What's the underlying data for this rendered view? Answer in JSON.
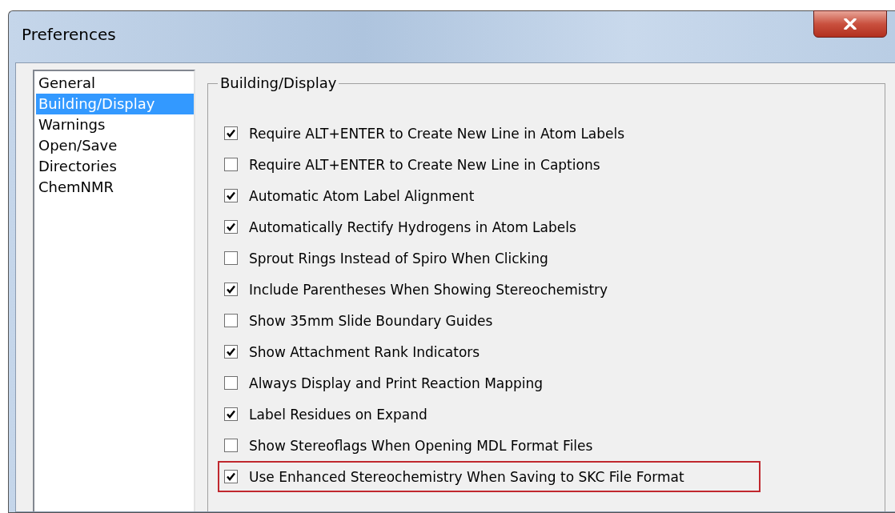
{
  "window": {
    "title": "Preferences"
  },
  "sidebar": {
    "items": [
      {
        "label": "General",
        "selected": false
      },
      {
        "label": "Building/Display",
        "selected": true
      },
      {
        "label": "Warnings",
        "selected": false
      },
      {
        "label": "Open/Save",
        "selected": false
      },
      {
        "label": "Directories",
        "selected": false
      },
      {
        "label": "ChemNMR",
        "selected": false
      }
    ]
  },
  "group": {
    "title": "Building/Display",
    "options": [
      {
        "label": "Require ALT+ENTER to Create New Line in Atom Labels",
        "checked": true,
        "highlighted": false
      },
      {
        "label": "Require ALT+ENTER to Create New Line in Captions",
        "checked": false,
        "highlighted": false
      },
      {
        "label": "Automatic Atom Label Alignment",
        "checked": true,
        "highlighted": false
      },
      {
        "label": "Automatically Rectify Hydrogens in Atom Labels",
        "checked": true,
        "highlighted": false
      },
      {
        "label": "Sprout Rings Instead of Spiro When Clicking",
        "checked": false,
        "highlighted": false
      },
      {
        "label": "Include Parentheses When Showing Stereochemistry",
        "checked": true,
        "highlighted": false
      },
      {
        "label": "Show 35mm Slide Boundary Guides",
        "checked": false,
        "highlighted": false
      },
      {
        "label": "Show Attachment Rank Indicators",
        "checked": true,
        "highlighted": false
      },
      {
        "label": "Always Display and Print Reaction Mapping",
        "checked": false,
        "highlighted": false
      },
      {
        "label": "Label Residues on Expand",
        "checked": true,
        "highlighted": false
      },
      {
        "label": "Show Stereoflags When Opening MDL Format Files",
        "checked": false,
        "highlighted": false
      },
      {
        "label": "Use Enhanced Stereochemistry When Saving to SKC File Format",
        "checked": true,
        "highlighted": true
      }
    ]
  }
}
